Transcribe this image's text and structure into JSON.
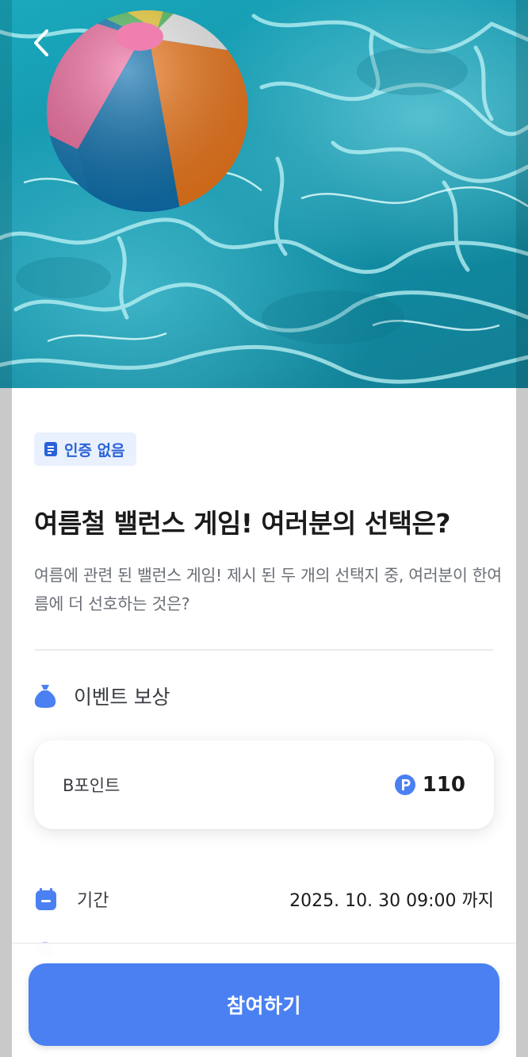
{
  "hero": {
    "back_icon": "chevron-left-icon",
    "image_subject": "beach-ball-in-pool"
  },
  "badge": {
    "icon": "document-icon",
    "label": "인증 없음"
  },
  "event": {
    "title": "여름철 밸런스 게임! 여러분의 선택은?",
    "description": "여름에 관련 된 밸런스 게임! 제시 된 두 개의 선택지 중, 여러분이 한여름에 더 선호하는 것은?"
  },
  "reward": {
    "section_icon": "money-bag-icon",
    "section_title": "이벤트 보상",
    "item_name": "B포인트",
    "point_icon": "point-coin-icon",
    "amount": "110"
  },
  "period": {
    "icon": "calendar-icon",
    "label": "기간",
    "value": "2025. 10. 30 09:00 까지"
  },
  "cta": {
    "label": "참여하기"
  },
  "colors": {
    "accent": "#4a80f2",
    "badge_bg": "#e9f0fe",
    "badge_text": "#2a63d6",
    "icon_blue": "#4a80f2"
  }
}
